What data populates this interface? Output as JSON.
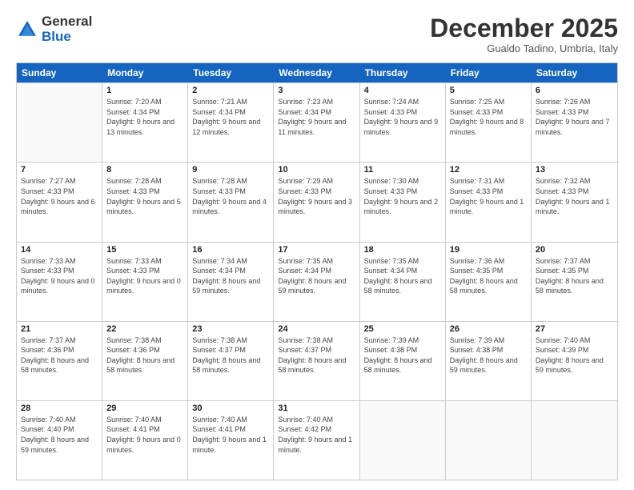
{
  "header": {
    "logo": {
      "general": "General",
      "blue": "Blue"
    },
    "title": "December 2025",
    "location": "Gualdo Tadino, Umbria, Italy"
  },
  "days_of_week": [
    "Sunday",
    "Monday",
    "Tuesday",
    "Wednesday",
    "Thursday",
    "Friday",
    "Saturday"
  ],
  "weeks": [
    [
      {
        "day": "",
        "empty": true
      },
      {
        "day": "1",
        "sunrise": "Sunrise: 7:20 AM",
        "sunset": "Sunset: 4:34 PM",
        "daylight": "Daylight: 9 hours and 13 minutes."
      },
      {
        "day": "2",
        "sunrise": "Sunrise: 7:21 AM",
        "sunset": "Sunset: 4:34 PM",
        "daylight": "Daylight: 9 hours and 12 minutes."
      },
      {
        "day": "3",
        "sunrise": "Sunrise: 7:23 AM",
        "sunset": "Sunset: 4:34 PM",
        "daylight": "Daylight: 9 hours and 11 minutes."
      },
      {
        "day": "4",
        "sunrise": "Sunrise: 7:24 AM",
        "sunset": "Sunset: 4:33 PM",
        "daylight": "Daylight: 9 hours and 9 minutes."
      },
      {
        "day": "5",
        "sunrise": "Sunrise: 7:25 AM",
        "sunset": "Sunset: 4:33 PM",
        "daylight": "Daylight: 9 hours and 8 minutes."
      },
      {
        "day": "6",
        "sunrise": "Sunrise: 7:26 AM",
        "sunset": "Sunset: 4:33 PM",
        "daylight": "Daylight: 9 hours and 7 minutes."
      }
    ],
    [
      {
        "day": "7",
        "sunrise": "Sunrise: 7:27 AM",
        "sunset": "Sunset: 4:33 PM",
        "daylight": "Daylight: 9 hours and 6 minutes."
      },
      {
        "day": "8",
        "sunrise": "Sunrise: 7:28 AM",
        "sunset": "Sunset: 4:33 PM",
        "daylight": "Daylight: 9 hours and 5 minutes."
      },
      {
        "day": "9",
        "sunrise": "Sunrise: 7:28 AM",
        "sunset": "Sunset: 4:33 PM",
        "daylight": "Daylight: 9 hours and 4 minutes."
      },
      {
        "day": "10",
        "sunrise": "Sunrise: 7:29 AM",
        "sunset": "Sunset: 4:33 PM",
        "daylight": "Daylight: 9 hours and 3 minutes."
      },
      {
        "day": "11",
        "sunrise": "Sunrise: 7:30 AM",
        "sunset": "Sunset: 4:33 PM",
        "daylight": "Daylight: 9 hours and 2 minutes."
      },
      {
        "day": "12",
        "sunrise": "Sunrise: 7:31 AM",
        "sunset": "Sunset: 4:33 PM",
        "daylight": "Daylight: 9 hours and 1 minute."
      },
      {
        "day": "13",
        "sunrise": "Sunrise: 7:32 AM",
        "sunset": "Sunset: 4:33 PM",
        "daylight": "Daylight: 9 hours and 1 minute."
      }
    ],
    [
      {
        "day": "14",
        "sunrise": "Sunrise: 7:33 AM",
        "sunset": "Sunset: 4:33 PM",
        "daylight": "Daylight: 9 hours and 0 minutes."
      },
      {
        "day": "15",
        "sunrise": "Sunrise: 7:33 AM",
        "sunset": "Sunset: 4:33 PM",
        "daylight": "Daylight: 9 hours and 0 minutes."
      },
      {
        "day": "16",
        "sunrise": "Sunrise: 7:34 AM",
        "sunset": "Sunset: 4:34 PM",
        "daylight": "Daylight: 8 hours and 59 minutes."
      },
      {
        "day": "17",
        "sunrise": "Sunrise: 7:35 AM",
        "sunset": "Sunset: 4:34 PM",
        "daylight": "Daylight: 8 hours and 59 minutes."
      },
      {
        "day": "18",
        "sunrise": "Sunrise: 7:35 AM",
        "sunset": "Sunset: 4:34 PM",
        "daylight": "Daylight: 8 hours and 58 minutes."
      },
      {
        "day": "19",
        "sunrise": "Sunrise: 7:36 AM",
        "sunset": "Sunset: 4:35 PM",
        "daylight": "Daylight: 8 hours and 58 minutes."
      },
      {
        "day": "20",
        "sunrise": "Sunrise: 7:37 AM",
        "sunset": "Sunset: 4:35 PM",
        "daylight": "Daylight: 8 hours and 58 minutes."
      }
    ],
    [
      {
        "day": "21",
        "sunrise": "Sunrise: 7:37 AM",
        "sunset": "Sunset: 4:36 PM",
        "daylight": "Daylight: 8 hours and 58 minutes."
      },
      {
        "day": "22",
        "sunrise": "Sunrise: 7:38 AM",
        "sunset": "Sunset: 4:36 PM",
        "daylight": "Daylight: 8 hours and 58 minutes."
      },
      {
        "day": "23",
        "sunrise": "Sunrise: 7:38 AM",
        "sunset": "Sunset: 4:37 PM",
        "daylight": "Daylight: 8 hours and 58 minutes."
      },
      {
        "day": "24",
        "sunrise": "Sunrise: 7:38 AM",
        "sunset": "Sunset: 4:37 PM",
        "daylight": "Daylight: 8 hours and 58 minutes."
      },
      {
        "day": "25",
        "sunrise": "Sunrise: 7:39 AM",
        "sunset": "Sunset: 4:38 PM",
        "daylight": "Daylight: 8 hours and 58 minutes."
      },
      {
        "day": "26",
        "sunrise": "Sunrise: 7:39 AM",
        "sunset": "Sunset: 4:38 PM",
        "daylight": "Daylight: 8 hours and 59 minutes."
      },
      {
        "day": "27",
        "sunrise": "Sunrise: 7:40 AM",
        "sunset": "Sunset: 4:39 PM",
        "daylight": "Daylight: 8 hours and 59 minutes."
      }
    ],
    [
      {
        "day": "28",
        "sunrise": "Sunrise: 7:40 AM",
        "sunset": "Sunset: 4:40 PM",
        "daylight": "Daylight: 8 hours and 59 minutes."
      },
      {
        "day": "29",
        "sunrise": "Sunrise: 7:40 AM",
        "sunset": "Sunset: 4:41 PM",
        "daylight": "Daylight: 9 hours and 0 minutes."
      },
      {
        "day": "30",
        "sunrise": "Sunrise: 7:40 AM",
        "sunset": "Sunset: 4:41 PM",
        "daylight": "Daylight: 9 hours and 1 minute."
      },
      {
        "day": "31",
        "sunrise": "Sunrise: 7:40 AM",
        "sunset": "Sunset: 4:42 PM",
        "daylight": "Daylight: 9 hours and 1 minute."
      },
      {
        "day": "",
        "empty": true
      },
      {
        "day": "",
        "empty": true
      },
      {
        "day": "",
        "empty": true
      }
    ]
  ]
}
